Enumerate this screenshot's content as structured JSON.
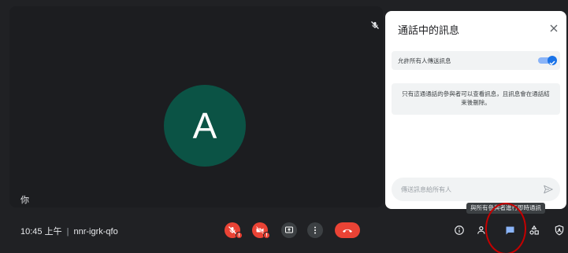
{
  "meeting": {
    "time": "10:45 上午",
    "separator": "|",
    "code": "nnr-igrk-qfo"
  },
  "tile": {
    "avatar_letter": "A",
    "self_label": "你"
  },
  "chat_panel": {
    "title": "通話中的訊息",
    "allow_toggle_label": "允許所有人傳送訊息",
    "allow_toggle_on": true,
    "info_text": "只有這通通話的參與者可以查看訊息，且訊息會在通話結束後刪除。",
    "compose_placeholder": "傳送訊息給所有人"
  },
  "tooltip": {
    "text": "與所有參與者進行即時通訊"
  },
  "controls": {
    "mic": "mic-off-icon",
    "camera": "camera-off-icon",
    "present": "present-screen-icon",
    "more": "more-options-icon",
    "leave": "end-call-icon"
  },
  "side_controls": {
    "info": "info-icon",
    "people": "people-icon",
    "chat": "chat-icon",
    "activities": "activities-icon",
    "host": "host-controls-icon"
  },
  "colors": {
    "background": "#202124",
    "avatar": "#0b5345",
    "danger": "#ea4335",
    "accent": "#1a73e8",
    "chat_active": "#8ab4f8",
    "annotation": "#c40000"
  }
}
